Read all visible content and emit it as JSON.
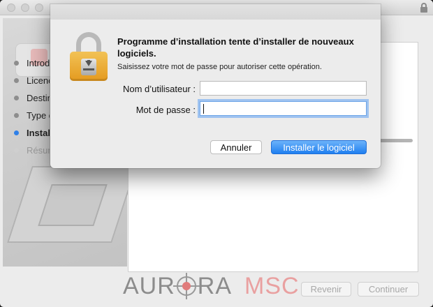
{
  "installer": {
    "steps": [
      {
        "label": "Introd",
        "state": "done"
      },
      {
        "label": "Licenc",
        "state": "done"
      },
      {
        "label": "Destin",
        "state": "done"
      },
      {
        "label": "Type d",
        "state": "done"
      },
      {
        "label": "Instal",
        "state": "active"
      },
      {
        "label": "Résum",
        "state": "pending"
      }
    ],
    "back_label": "Revenir",
    "continue_label": "Continuer",
    "watermark": {
      "left": "AUR",
      "right": "RA",
      "suffix": "MSC"
    }
  },
  "auth": {
    "title": "Programme d’installation tente d’installer de nouveaux logiciels.",
    "subtitle": "Saisissez votre mot de passe pour autoriser cette opération.",
    "username_label": "Nom d’utilisateur :",
    "username_value": "",
    "password_label": "Mot de passe :",
    "password_value": "",
    "cancel_label": "Annuler",
    "install_label": "Installer le logiciel"
  },
  "icons": {
    "lock": "lock-icon",
    "window_lock": "lock-icon"
  },
  "colors": {
    "accent": "#2f80e8",
    "lock_body": "#e49a1f",
    "watermark_red": "#e07b7b"
  }
}
